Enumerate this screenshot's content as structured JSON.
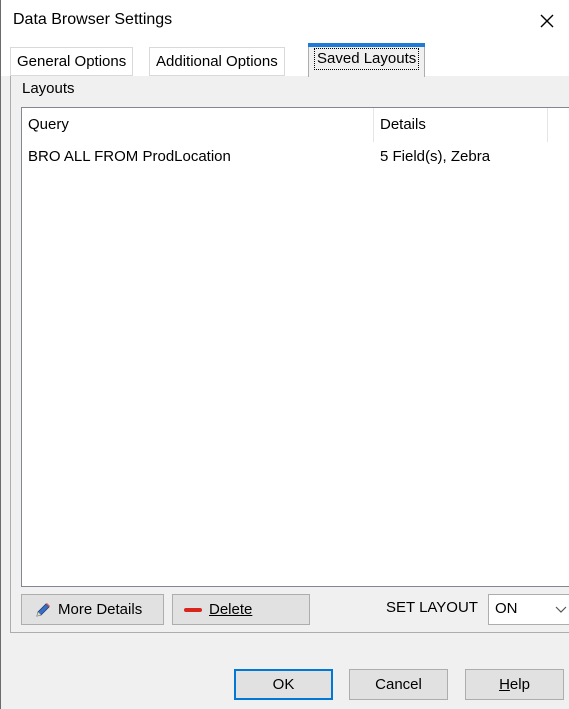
{
  "window": {
    "title": "Data Browser Settings"
  },
  "tabs": [
    {
      "label": "General Options",
      "active": false
    },
    {
      "label": "Additional Options",
      "active": false
    },
    {
      "label": "Saved Layouts",
      "active": true
    }
  ],
  "layouts_group": {
    "title": "Layouts",
    "columns": [
      "Query",
      "Details"
    ],
    "rows": [
      {
        "query": "BRO ALL FROM ProdLocation",
        "details": "5 Field(s), Zebra"
      }
    ]
  },
  "actions": {
    "more_details": "More Details",
    "delete": "Delete",
    "set_layout_label": "SET LAYOUT",
    "set_layout_value": "ON"
  },
  "footer": {
    "ok": "OK",
    "cancel": "Cancel",
    "help": "Help"
  },
  "icons": {
    "close": "close-icon",
    "more_details": "pencil-icon",
    "delete": "delete-icon",
    "dropdown": "chevron-down-icon"
  },
  "colors": {
    "accent": "#1f7bd6",
    "delete_icon": "#d9261c",
    "focus_border": "#0078d7"
  }
}
